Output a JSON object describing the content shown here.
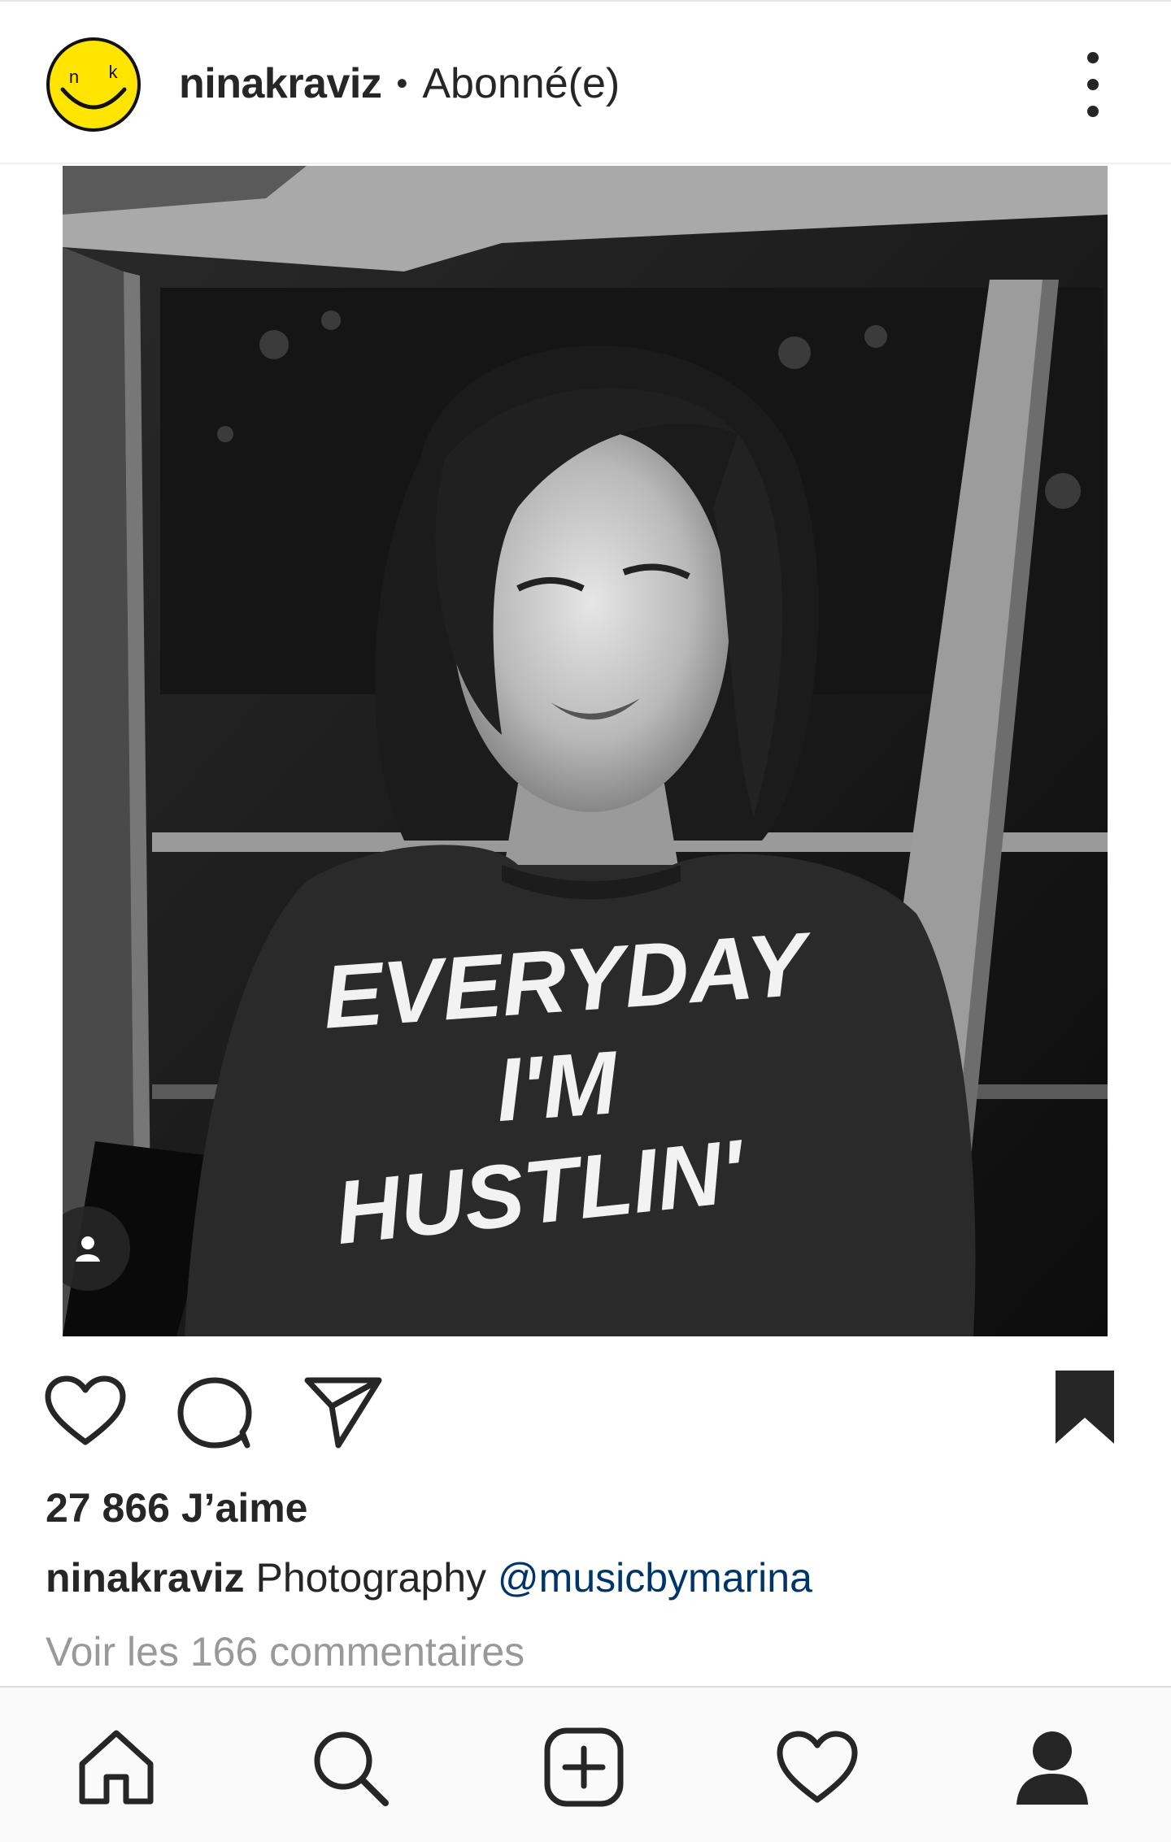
{
  "header": {
    "username": "ninakraviz",
    "separator": "•",
    "follow_status": "Abonné(e)",
    "avatar_letters": [
      "n",
      "k"
    ],
    "avatar_color": "#FFE500"
  },
  "post": {
    "shirt_text": [
      "EVERYDAY",
      "I'M",
      "HUSTLIN'"
    ],
    "likes": "27 866 J’aime",
    "caption_user": "ninakraviz",
    "caption_text": "Photography",
    "caption_mention": "@musicbymarina",
    "view_comments": "Voir les 166 commentaires"
  },
  "colors": {
    "text": "#262626",
    "mention": "#003569",
    "muted": "#999999",
    "nav_bg": "#fafafa"
  },
  "icons": {
    "like": "heart-icon",
    "comment": "comment-icon",
    "share": "send-icon",
    "save": "bookmark-icon",
    "tag": "user-tag-icon",
    "nav": [
      "home-icon",
      "search-icon",
      "add-post-icon",
      "activity-heart-icon",
      "profile-icon"
    ]
  }
}
